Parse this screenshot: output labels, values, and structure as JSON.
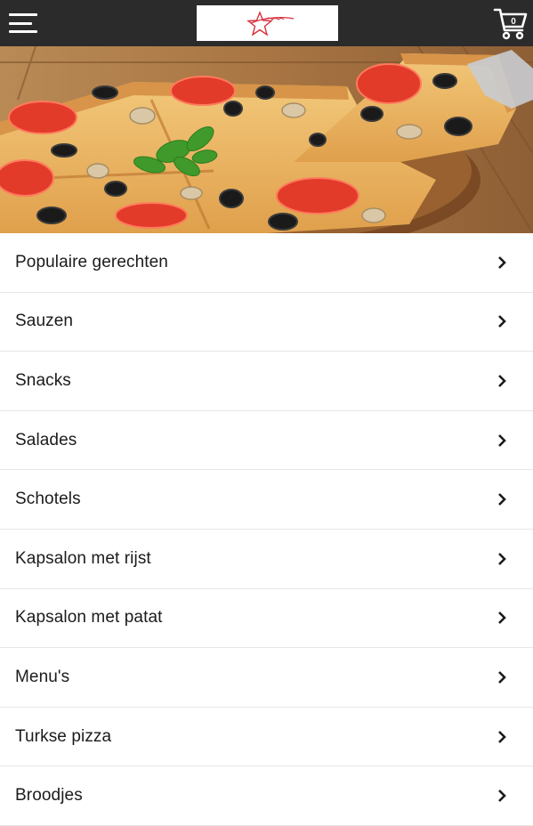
{
  "header": {
    "menu_icon": "hamburger-menu-icon",
    "logo_icon": "star-logo",
    "cart_icon": "shopping-cart-icon",
    "cart_count": "0",
    "background_color": "#2b2b2b"
  },
  "hero": {
    "image": "pizza-photo"
  },
  "categories": [
    {
      "label": "Populaire gerechten"
    },
    {
      "label": "Sauzen"
    },
    {
      "label": "Snacks"
    },
    {
      "label": "Salades"
    },
    {
      "label": "Schotels"
    },
    {
      "label": "Kapsalon met rijst"
    },
    {
      "label": "Kapsalon met patat"
    },
    {
      "label": "Menu's"
    },
    {
      "label": "Turkse pizza"
    },
    {
      "label": "Broodjes"
    }
  ],
  "colors": {
    "accent": "#d6303b",
    "divider": "#e6e6e6"
  }
}
